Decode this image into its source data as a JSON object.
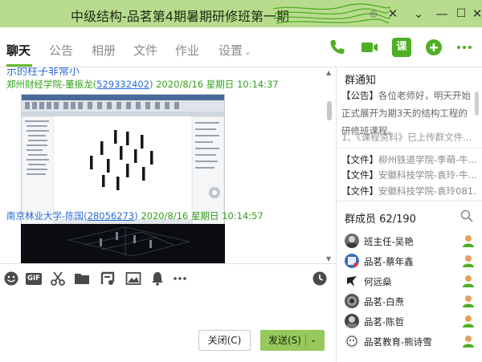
{
  "window": {
    "title": "中级结构-品茗第4期暑期研修班第一期"
  },
  "tabs": [
    {
      "label": "聊天",
      "active": true
    },
    {
      "label": "公告",
      "active": false
    },
    {
      "label": "相册",
      "active": false
    },
    {
      "label": "文件",
      "active": false
    },
    {
      "label": "作业",
      "active": false
    },
    {
      "label": "设置",
      "active": false
    }
  ],
  "toolbar_icons": [
    "phone-icon",
    "video-icon",
    "class-icon",
    "add-icon",
    "more-icon"
  ],
  "class_icon_text": "课",
  "chat": {
    "cut_line": "示的柱子非常小",
    "messages": [
      {
        "sender": "郑州财经学院-董振龙",
        "qq": "529332402",
        "time": "2020/8/16 星期日 10:14:37"
      },
      {
        "sender": "南京林业大学-陈国",
        "qq": "28056273",
        "time": "2020/8/16 星期日 10:14:57"
      }
    ]
  },
  "input_toolbar_icons": [
    "emoji-icon",
    "gif-icon",
    "scissors-icon",
    "folder-icon",
    "music-icon",
    "image-icon",
    "bell-icon",
    "more-dots-icon",
    "clock-icon"
  ],
  "gif_label": "GIF",
  "buttons": {
    "close": "关闭(C)",
    "send": "发送(S)"
  },
  "notice": {
    "title": "群通知",
    "tag": "【公告】",
    "text": "各位老师好，明天开始正式展开为期3天的结构工程的研修班课程。",
    "more": "1、《课程资料》已上传群文件..."
  },
  "files": [
    {
      "tag": "【文件】",
      "name": "柳州铁道学院-李萌-牛..."
    },
    {
      "tag": "【文件】",
      "name": "安徽科技学院-袁玲-牛..."
    },
    {
      "tag": "【文件】",
      "name": "安徽科技学院-袁玲081..."
    }
  ],
  "members": {
    "label": "群成员",
    "count": "62/190",
    "list": [
      {
        "name": "班主任-吴艳"
      },
      {
        "name": "品茗-蔡年鑫"
      },
      {
        "name": "何远燊"
      },
      {
        "name": "品茗-白焘"
      },
      {
        "name": "品茗-陈哲"
      },
      {
        "name": "品茗教育-熊诗雪"
      }
    ]
  },
  "colors": {
    "titlebar": "#b8dc8e",
    "accent_green": "#66b82e",
    "send_button": "#96c85c",
    "link_blue": "#2a6bd6",
    "sender_green": "#33a11b"
  }
}
